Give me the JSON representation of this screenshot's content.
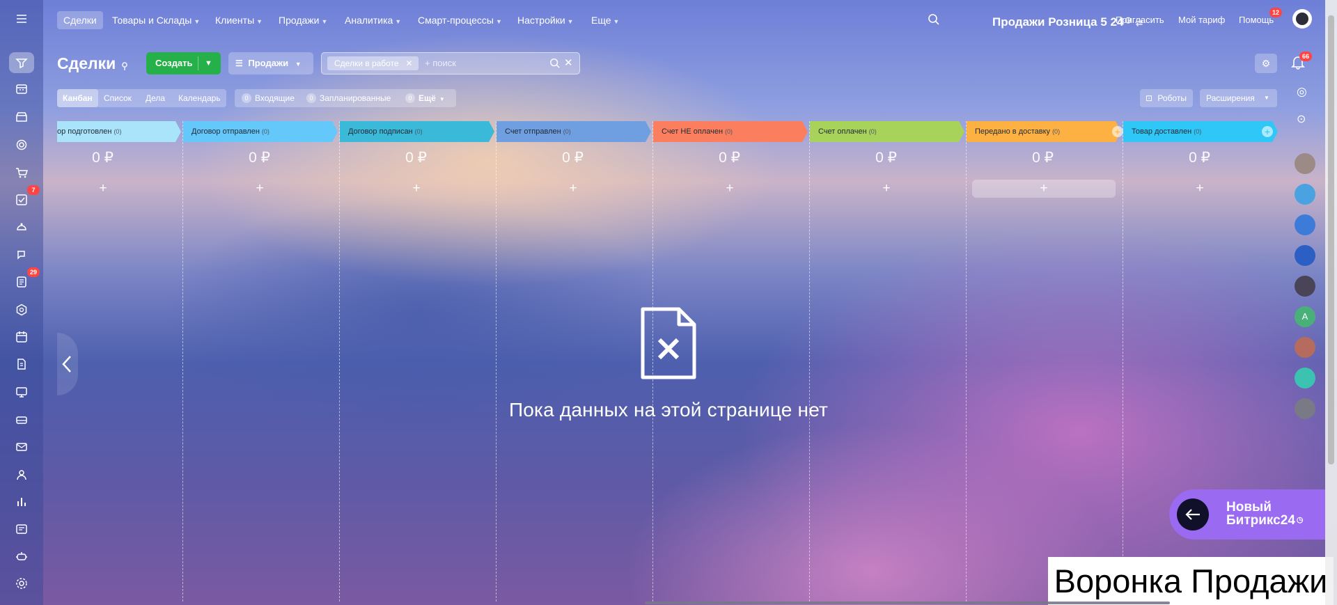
{
  "top_nav": {
    "items": [
      {
        "label": "Сделки",
        "active": true,
        "chevron": false
      },
      {
        "label": "Товары и Склады",
        "chevron": true
      },
      {
        "label": "Клиенты",
        "chevron": true
      },
      {
        "label": "Продажи",
        "chevron": true
      },
      {
        "label": "Аналитика",
        "chevron": true
      },
      {
        "label": "Смарт-процессы",
        "chevron": true
      },
      {
        "label": "Настройки",
        "chevron": true
      },
      {
        "label": "Еще",
        "chevron": true
      }
    ],
    "portal_title": "Продажи Розница 5 24",
    "invite": "Пригласить",
    "tariff": "Мой тариф",
    "help": "Помощь",
    "help_badge": "12",
    "notifications_badge": "66"
  },
  "left_rail": {
    "tasks_badge": "7",
    "feed_badge": "29",
    "icons": [
      "menu-icon",
      "crm-icon",
      "calendar-grid-icon",
      "store-icon",
      "target-icon",
      "cart-icon",
      "tasks-icon",
      "robot-icon",
      "chat-icon",
      "feed-icon",
      "hexagon-icon",
      "calendar-icon",
      "doc-icon",
      "board-icon",
      "drive-icon",
      "mail-icon",
      "groups-icon",
      "chart-icon",
      "sites-icon",
      "bot-icon",
      "settings-icon"
    ]
  },
  "toolbar": {
    "title": "Сделки",
    "create": "Создать",
    "funnel": "Продажи",
    "filter_chip": "Сделки в работе",
    "search_placeholder": "+ поиск"
  },
  "views": {
    "kanban": "Канбан",
    "list": "Список",
    "activities": "Дела",
    "calendar": "Календарь"
  },
  "counters": {
    "incoming_num": "0",
    "incoming": "Входящие",
    "planned_num": "0",
    "planned": "Запланированные",
    "more_num": "0",
    "more": "Ещё"
  },
  "right_buttons": {
    "robots": "Роботы",
    "extensions": "Расширения"
  },
  "stages": [
    {
      "name": "ор подготовлен",
      "count": "(0)",
      "sum": "0 ₽",
      "color": "#a9e4fb"
    },
    {
      "name": "Договор отправлен",
      "count": "(0)",
      "sum": "0 ₽",
      "color": "#64c8fb"
    },
    {
      "name": "Договор подписан",
      "count": "(0)",
      "sum": "0 ₽",
      "color": "#3bb9d8"
    },
    {
      "name": "Счет отправлен",
      "count": "(0)",
      "sum": "0 ₽",
      "color": "#6f9fe0"
    },
    {
      "name": "Счет НЕ оплачен",
      "count": "(0)",
      "sum": "0 ₽",
      "color": "#fb7f5f"
    },
    {
      "name": "Счет оплачен",
      "count": "(0)",
      "sum": "0 ₽",
      "color": "#a7d35b"
    },
    {
      "name": "Передано в доставку",
      "count": "(0)",
      "sum": "0 ₽",
      "color": "#fdb142"
    },
    {
      "name": "Товар доставлен",
      "count": "(0)",
      "sum": "0 ₽",
      "color": "#2fc7f7"
    }
  ],
  "add_symbol": "+",
  "empty_state": "Пока данных на этой странице нет",
  "promo": {
    "line1": "Новый",
    "line2": "Битрикс24"
  },
  "caption": "Воронка Продажи"
}
